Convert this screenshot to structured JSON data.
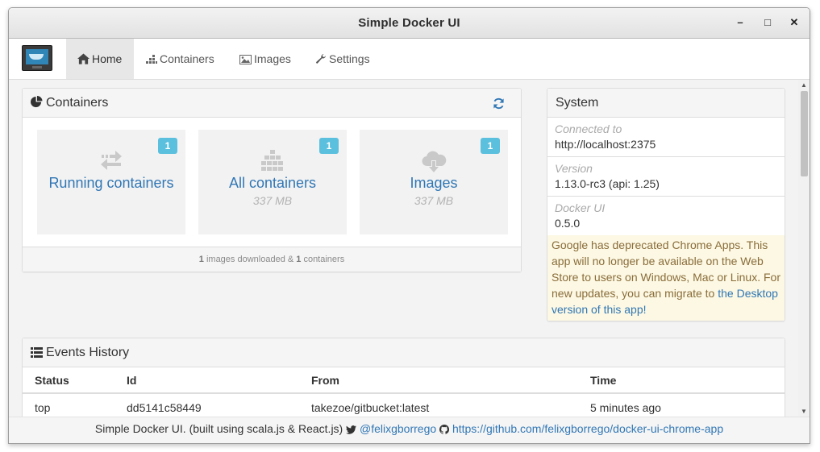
{
  "window": {
    "title": "Simple Docker UI",
    "minimize": "–",
    "maximize": "□",
    "close": "✕"
  },
  "nav": {
    "home": "Home",
    "containers": "Containers",
    "images": "Images",
    "settings": "Settings"
  },
  "containers_panel": {
    "title": "Containers",
    "tiles": [
      {
        "label": "Running containers",
        "sub": "",
        "badge": "1"
      },
      {
        "label": "All containers",
        "sub": "337 MB",
        "badge": "1"
      },
      {
        "label": "Images",
        "sub": "337 MB",
        "badge": "1"
      }
    ],
    "footer": {
      "images_count": "1",
      "images_text": " images downloaded & ",
      "containers_count": "1",
      "containers_text": " containers"
    }
  },
  "system_panel": {
    "title": "System",
    "items": [
      {
        "key": "Connected to",
        "value": "http://localhost:2375"
      },
      {
        "key": "Version",
        "value": "1.13.0-rc3 (api: 1.25)"
      },
      {
        "key": "Docker UI",
        "value": "0.5.0"
      }
    ],
    "warning": {
      "text": "Google has deprecated Chrome Apps. This app will no longer be available on the Web Store to users on Windows, Mac or Linux. For new updates, you can migrate to ",
      "link": "the Desktop version of this app!"
    }
  },
  "events_panel": {
    "title": "Events History",
    "columns": [
      "Status",
      "Id",
      "From",
      "Time"
    ],
    "rows": [
      [
        "top",
        "dd5141c58449",
        "takezoe/gitbucket:latest",
        "5 minutes ago"
      ]
    ]
  },
  "footer": {
    "text": "Simple Docker UI. (built using scala.js & React.js)",
    "twitter": "@felixgborrego",
    "github": "https://github.com/felixgborrego/docker-ui-chrome-app"
  },
  "colors": {
    "link": "#3177b5",
    "badge": "#5bc0de",
    "warning_bg": "#fcf8e3",
    "warning_text": "#8a6d3b"
  }
}
